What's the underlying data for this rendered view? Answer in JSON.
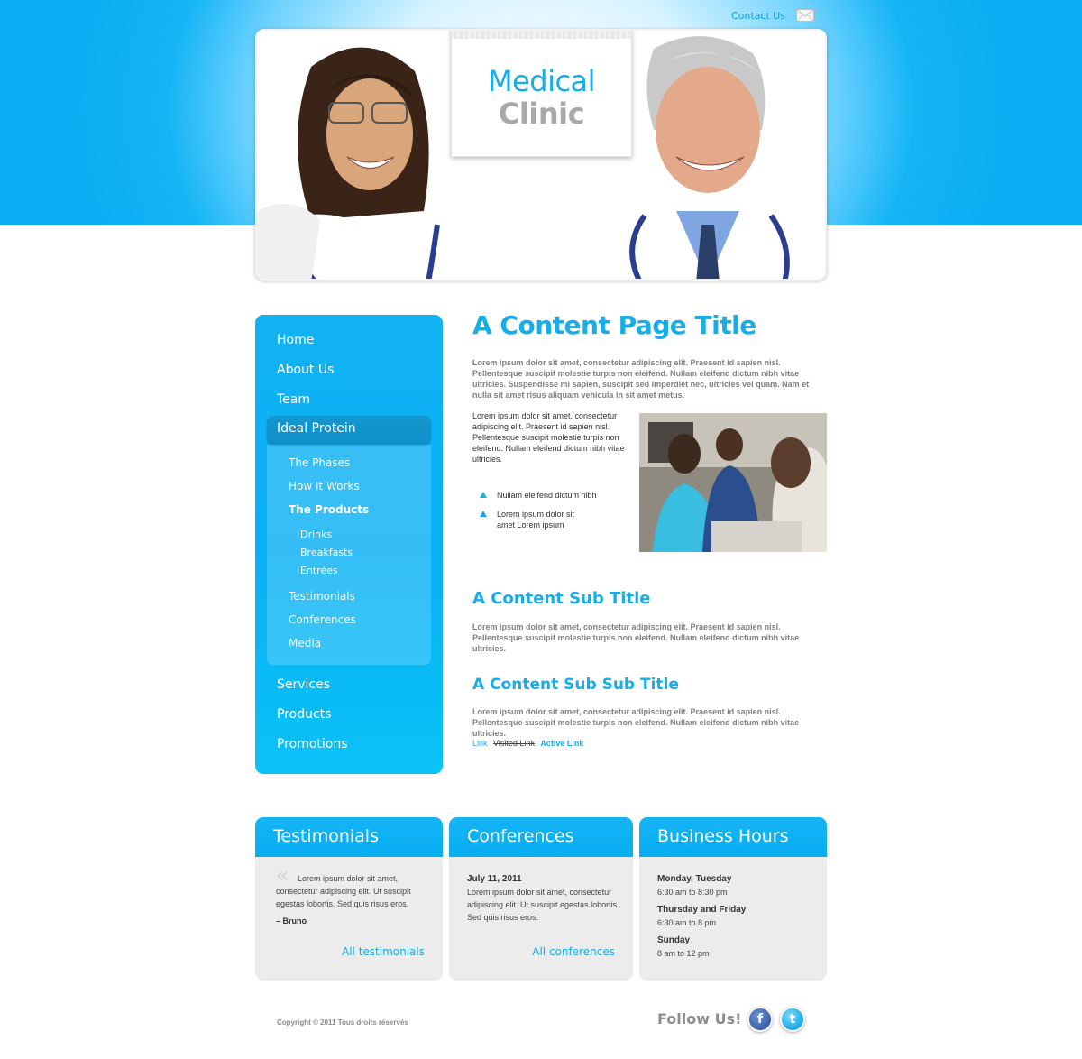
{
  "brand": {
    "line1": "Medical",
    "line2": "Clinic",
    "accent_color": "#16aee8",
    "secondary_color": "#a9a9a9"
  },
  "header": {
    "contact_label": "Contact Us",
    "contact_icon": "mail-icon"
  },
  "sidebar": {
    "items_top": [
      {
        "label": "Home"
      },
      {
        "label": "About Us"
      },
      {
        "label": "Team"
      }
    ],
    "active_item": "Ideal Protein",
    "subitems": [
      {
        "label": "The Phases"
      },
      {
        "label": "How It Works"
      },
      {
        "label": "The Products"
      }
    ],
    "subsubitems": [
      {
        "label": "Drinks"
      },
      {
        "label": "Breakfasts"
      },
      {
        "label": "Entrées"
      }
    ],
    "subitems_after": [
      {
        "label": "Testimonials"
      },
      {
        "label": "Conferences"
      },
      {
        "label": "Media"
      }
    ],
    "items_bottom": [
      {
        "label": "Services"
      },
      {
        "label": "Products"
      },
      {
        "label": "Promotions"
      }
    ]
  },
  "content": {
    "title": "A Content Page Title",
    "intro": "Lorem ipsum dolor sit amet, consectetur adipiscing elit. Praesent id sapien nisl. Pellentesque suscipit molestie turpis non eleifend. Nullam eleifend dictum nibh vitae ultricies. Suspendisse mi sapien, suscipit sed imperdiet nec, ultricies vel quam. Nam et nulla sit amet risus aliquam vehicula in sit amet metus.",
    "side_paragraph": "Lorem ipsum dolor sit amet, consectetur adipiscing elit. Praesent id sapien nisl. Pellentesque suscipit molestie turpis non eleifend. Nullam eleifend dictum nibh vitae ultricies.",
    "bullets": [
      {
        "text": "Nullam eleifend dictum nibh"
      },
      {
        "text": "Lorem ipsum dolor sit amet Lorem ipsum"
      }
    ],
    "sub_title": "A Content Sub Title",
    "sub_paragraph": "Lorem ipsum dolor sit amet, consectetur adipiscing elit. Praesent id sapien nisl. Pellentesque suscipit molestie turpis non eleifend. Nullam eleifend dictum nibh vitae ultricies.",
    "sub_sub_title": "A Content Sub Sub Title",
    "sub_sub_paragraph": "Lorem ipsum dolor sit amet, consectetur adipiscing elit. Praesent id sapien nisl. Pellentesque suscipit molestie turpis non eleifend. Nullam eleifend dictum nibh vitae ultricies.",
    "link_normal": "Link",
    "link_visited": "Visited Link",
    "link_active": "Active Link"
  },
  "boxes": {
    "testimonials": {
      "title": "Testimonials",
      "quote": "Lorem ipsum dolor sit amet, consectetur adipiscing elit. Ut suscipit egestas lobortis. Sed quis risus eros.",
      "author": "– Bruno",
      "link": "All testimonials"
    },
    "conferences": {
      "title": "Conferences",
      "date": "July 11, 2011",
      "text": "Lorem ipsum dolor sit amet, consectetur adipiscing elit. Ut suscipit egestas lobortis. Sed quis risus eros.",
      "link": "All conferences"
    },
    "hours": {
      "title": "Business Hours",
      "rows": [
        {
          "day": "Monday, Tuesday",
          "time": "6:30 am to 8:30 pm"
        },
        {
          "day": "Thursday and Friday",
          "time": "6:30 am to 8 pm"
        },
        {
          "day": "Sunday",
          "time": "8 am to 12 pm"
        }
      ]
    }
  },
  "footer": {
    "copyright": "Copyright © 2011 Tous droits réservés",
    "follow": "Follow Us!",
    "facebook_icon": "facebook-icon",
    "twitter_icon": "twitter-icon"
  }
}
